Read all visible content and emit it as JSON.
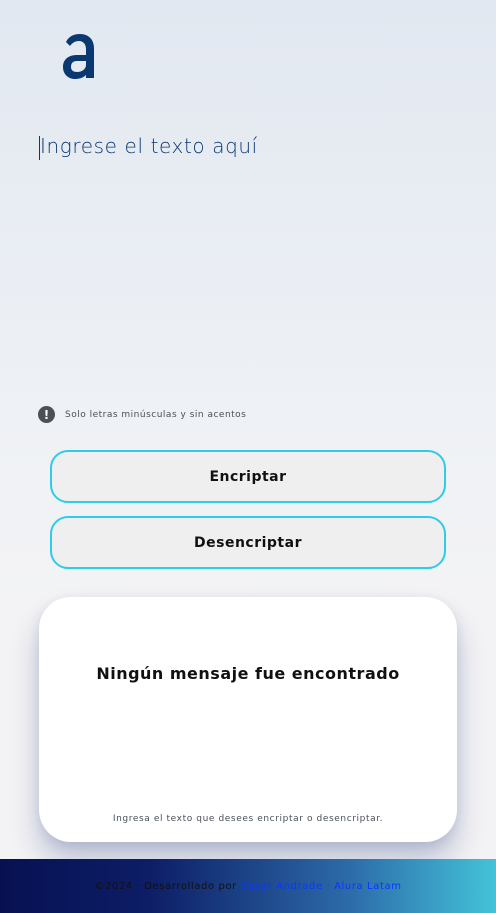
{
  "brand": {
    "logo_icon": "alura-a-logo-icon",
    "color": "#0a3871"
  },
  "input": {
    "placeholder": "Ingrese el texto aquí",
    "value": ""
  },
  "hint": {
    "icon": "exclamation-circle-icon",
    "text": "Solo letras minúsculas y sin acentos"
  },
  "buttons": {
    "encrypt_label": "Encriptar",
    "decrypt_label": "Desencriptar",
    "border_color": "#2ecbea"
  },
  "output": {
    "title": "Ningún mensaje fue encontrado",
    "subtitle": "Ingresa el texto que desees encriptar o desencriptar."
  },
  "footer": {
    "prefix": "©2024 · Desarrollado por ",
    "author_link": "Oscar Andrade",
    "separator": " · ",
    "org_link": "Alura Latam",
    "link_color": "#0b36ff"
  }
}
